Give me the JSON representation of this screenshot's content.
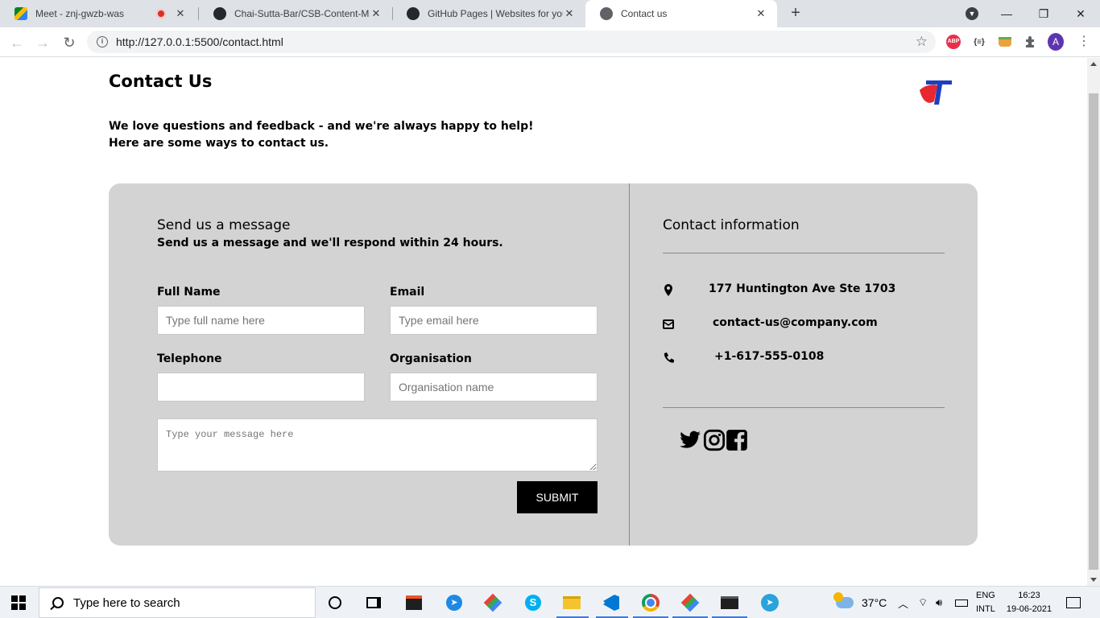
{
  "browser": {
    "tabs": [
      {
        "title": "Meet - znj-gwzb-was",
        "active": false
      },
      {
        "title": "Chai-Sutta-Bar/CSB-Content-Mar",
        "active": false
      },
      {
        "title": "GitHub Pages | Websites for you",
        "active": false
      },
      {
        "title": "Contact us",
        "active": true
      }
    ],
    "url": "http://127.0.0.1:5500/contact.html",
    "extensions": [
      "ABP",
      "{≡}"
    ],
    "profile_initial": "A"
  },
  "page": {
    "title": "Contact Us",
    "intro_line1": "We love questions and feedback - and we're always happy to help!",
    "intro_line2": "Here are some ways to contact us.",
    "form": {
      "title": "Send us a message",
      "subtitle": "Send us a message and we'll respond within 24 hours.",
      "full_name_label": "Full Name",
      "full_name_placeholder": "Type full name here",
      "email_label": "Email",
      "email_placeholder": "Type email here",
      "telephone_label": "Telephone",
      "telephone_placeholder": "",
      "organisation_label": "Organisation",
      "organisation_placeholder": "Organisation name",
      "message_placeholder": "Type your message here",
      "submit_label": "SUBMIT"
    },
    "contact": {
      "title": "Contact information",
      "address": "177 Huntington Ave Ste 1703",
      "email": "contact-us@company.com",
      "phone": "+1-617-555-0108"
    },
    "social": [
      "twitter-icon",
      "instagram-icon",
      "facebook-icon"
    ]
  },
  "taskbar": {
    "search_placeholder": "Type here to search",
    "temperature": "37°C",
    "lang_line1": "ENG",
    "lang_line2": "INTL",
    "time": "16:23",
    "date": "19-06-2021"
  },
  "colors": {
    "card_bg": "#d3d3d3",
    "submit_bg": "#000000",
    "logo_red": "#e8272f",
    "logo_blue": "#1f3fbf"
  }
}
